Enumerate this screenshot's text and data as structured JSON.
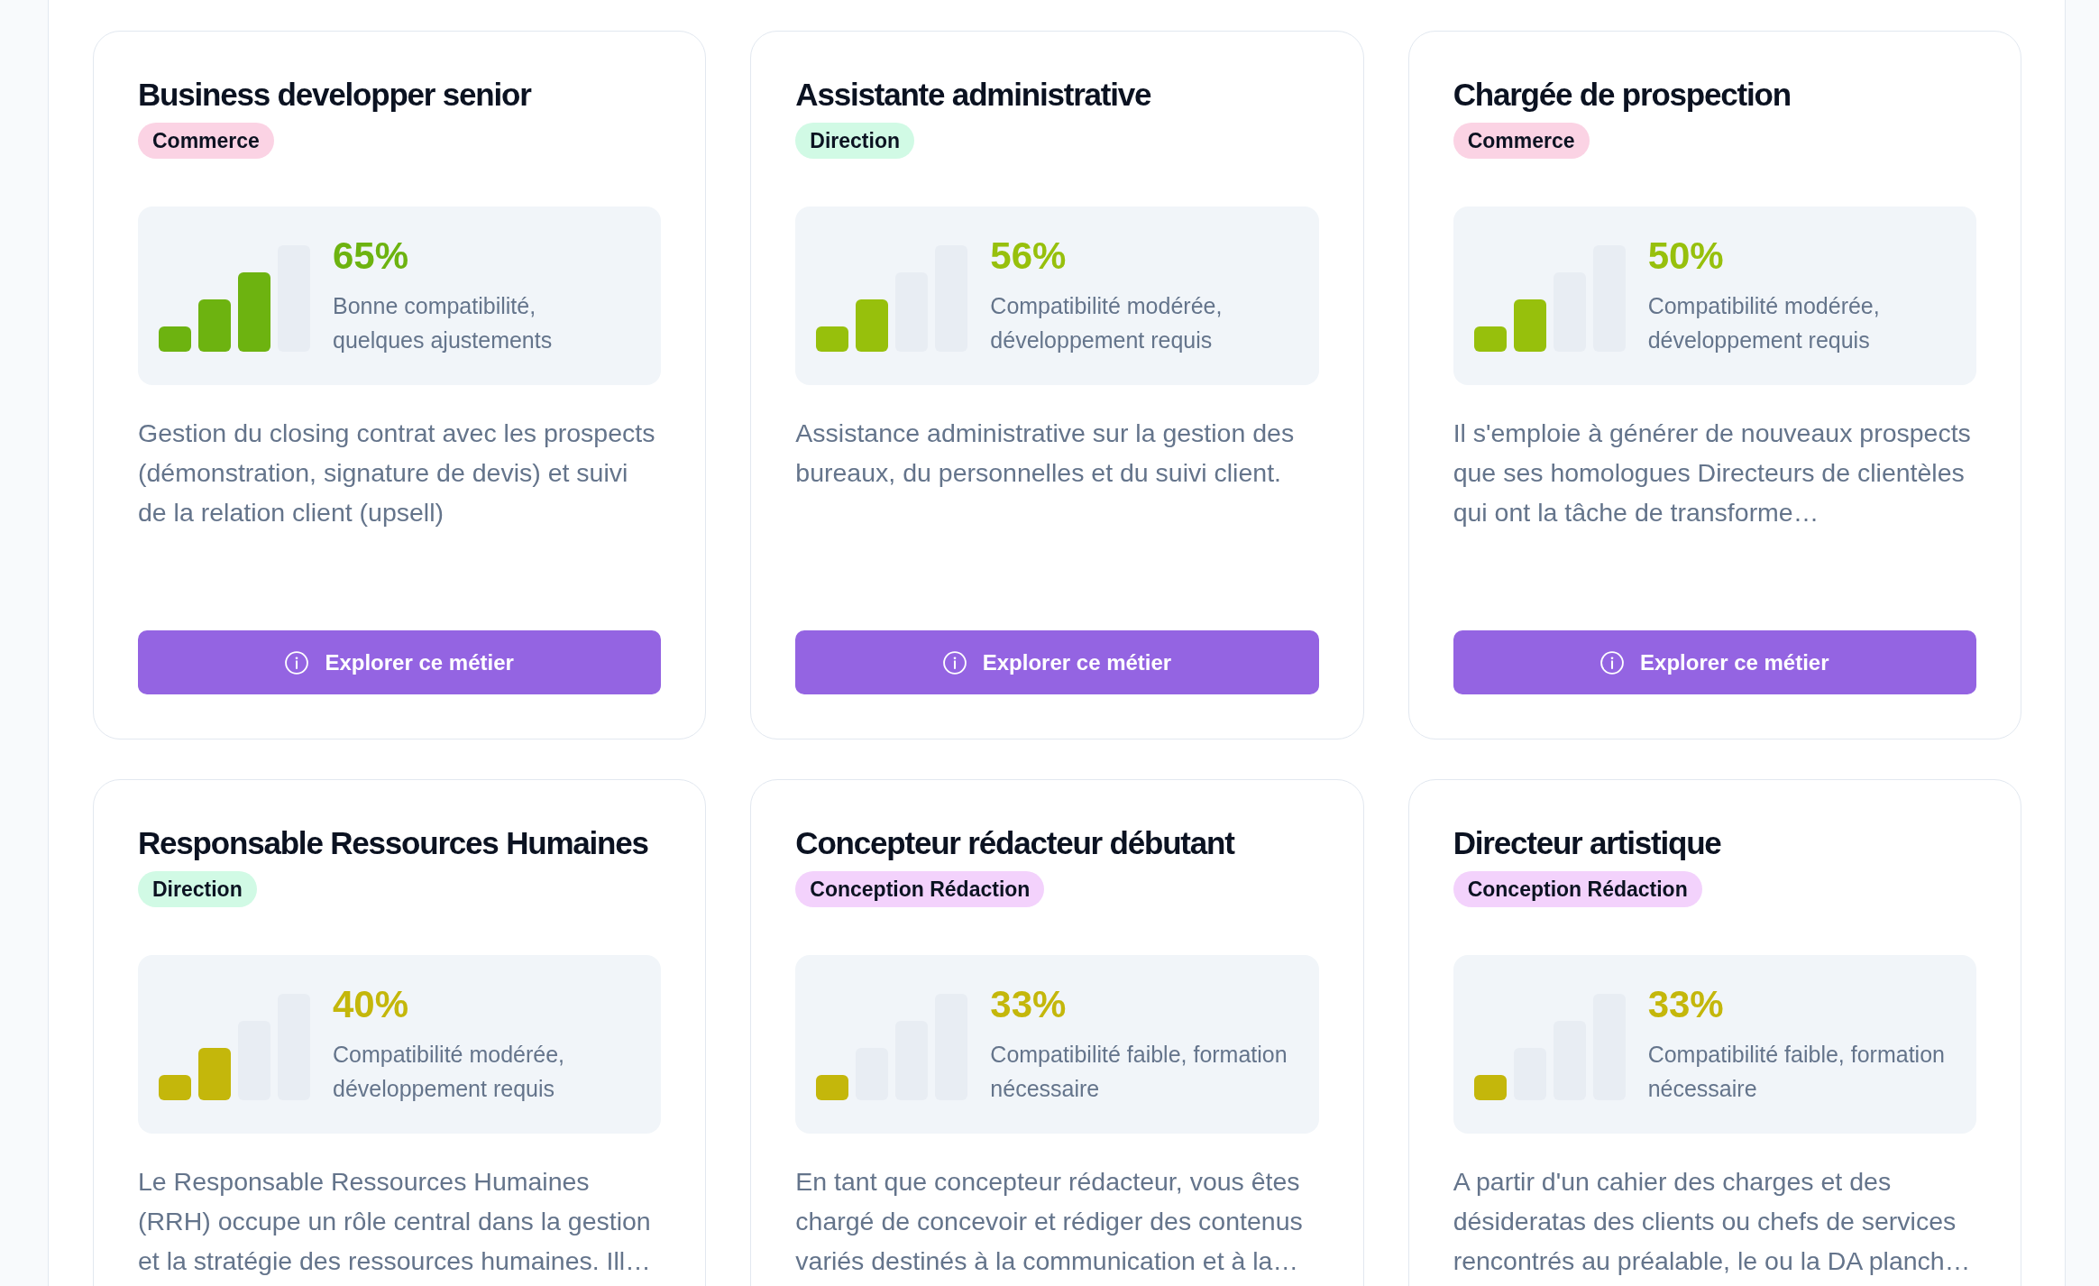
{
  "cards": [
    {
      "title": "Business developper senior",
      "category": {
        "label": "Commerce",
        "color": "#fbd3e4"
      },
      "compatibility": {
        "level": 0.75,
        "percent": "65%",
        "color": "#6db310",
        "summary": "Bonne compatibilité, quelques ajustements"
      },
      "description": "Gestion du closing contrat avec les prospects (démonstration, signature de devis) et suivi de la relation client (upsell)",
      "button": "Explorer ce métier"
    },
    {
      "title": "Assistante administrative",
      "category": {
        "label": "Direction",
        "color": "#d1fae5"
      },
      "compatibility": {
        "level": 0.5,
        "percent": "56%",
        "color": "#97c00c",
        "summary": "Compatibilité modérée, développement requis"
      },
      "description": "Assistance administrative sur la gestion des bureaux, du personnelles et du suivi client.",
      "button": "Explorer ce métier"
    },
    {
      "title": "Chargée de prospection",
      "category": {
        "label": "Commerce",
        "color": "#fbd3e4"
      },
      "compatibility": {
        "level": 0.5,
        "percent": "50%",
        "color": "#97c00c",
        "summary": "Compatibilité modérée, développement requis"
      },
      "description": "Il s'emploie à générer de nouveaux prospects que ses homologues Directeurs de clientèles qui ont la tâche de transforme…",
      "button": "Explorer ce métier"
    },
    {
      "title": "Responsable Ressources Humaines",
      "category": {
        "label": "Direction",
        "color": "#d1fae5"
      },
      "compatibility": {
        "level": 0.5,
        "percent": "40%",
        "color": "#c4b70b",
        "summary": "Compatibilité modérée, développement requis"
      },
      "description": "Le Responsable Ressources Humaines (RRH) occupe un rôle central dans la gestion et la stratégie des ressources humaines. Ill…"
    },
    {
      "title": "Concepteur rédacteur débutant",
      "category": {
        "label": "Conception Rédaction",
        "color": "#f3d2fc"
      },
      "compatibility": {
        "level": 0.25,
        "percent": "33%",
        "color": "#c4b70b",
        "summary": "Compatibilité faible, formation nécessaire"
      },
      "description": "En tant que concepteur rédacteur, vous êtes chargé de concevoir et rédiger des contenus variés destinés à la communication et à la…"
    },
    {
      "title": "Directeur artistique",
      "category": {
        "label": "Conception Rédaction",
        "color": "#f3d2fc"
      },
      "compatibility": {
        "level": 0.25,
        "percent": "33%",
        "color": "#c4b70b",
        "summary": "Compatibilité faible, formation nécessaire"
      },
      "description": "A partir d'un cahier des charges et des désideratas des clients ou chefs de services rencontrés au préalable, le ou la DA planch…"
    }
  ]
}
